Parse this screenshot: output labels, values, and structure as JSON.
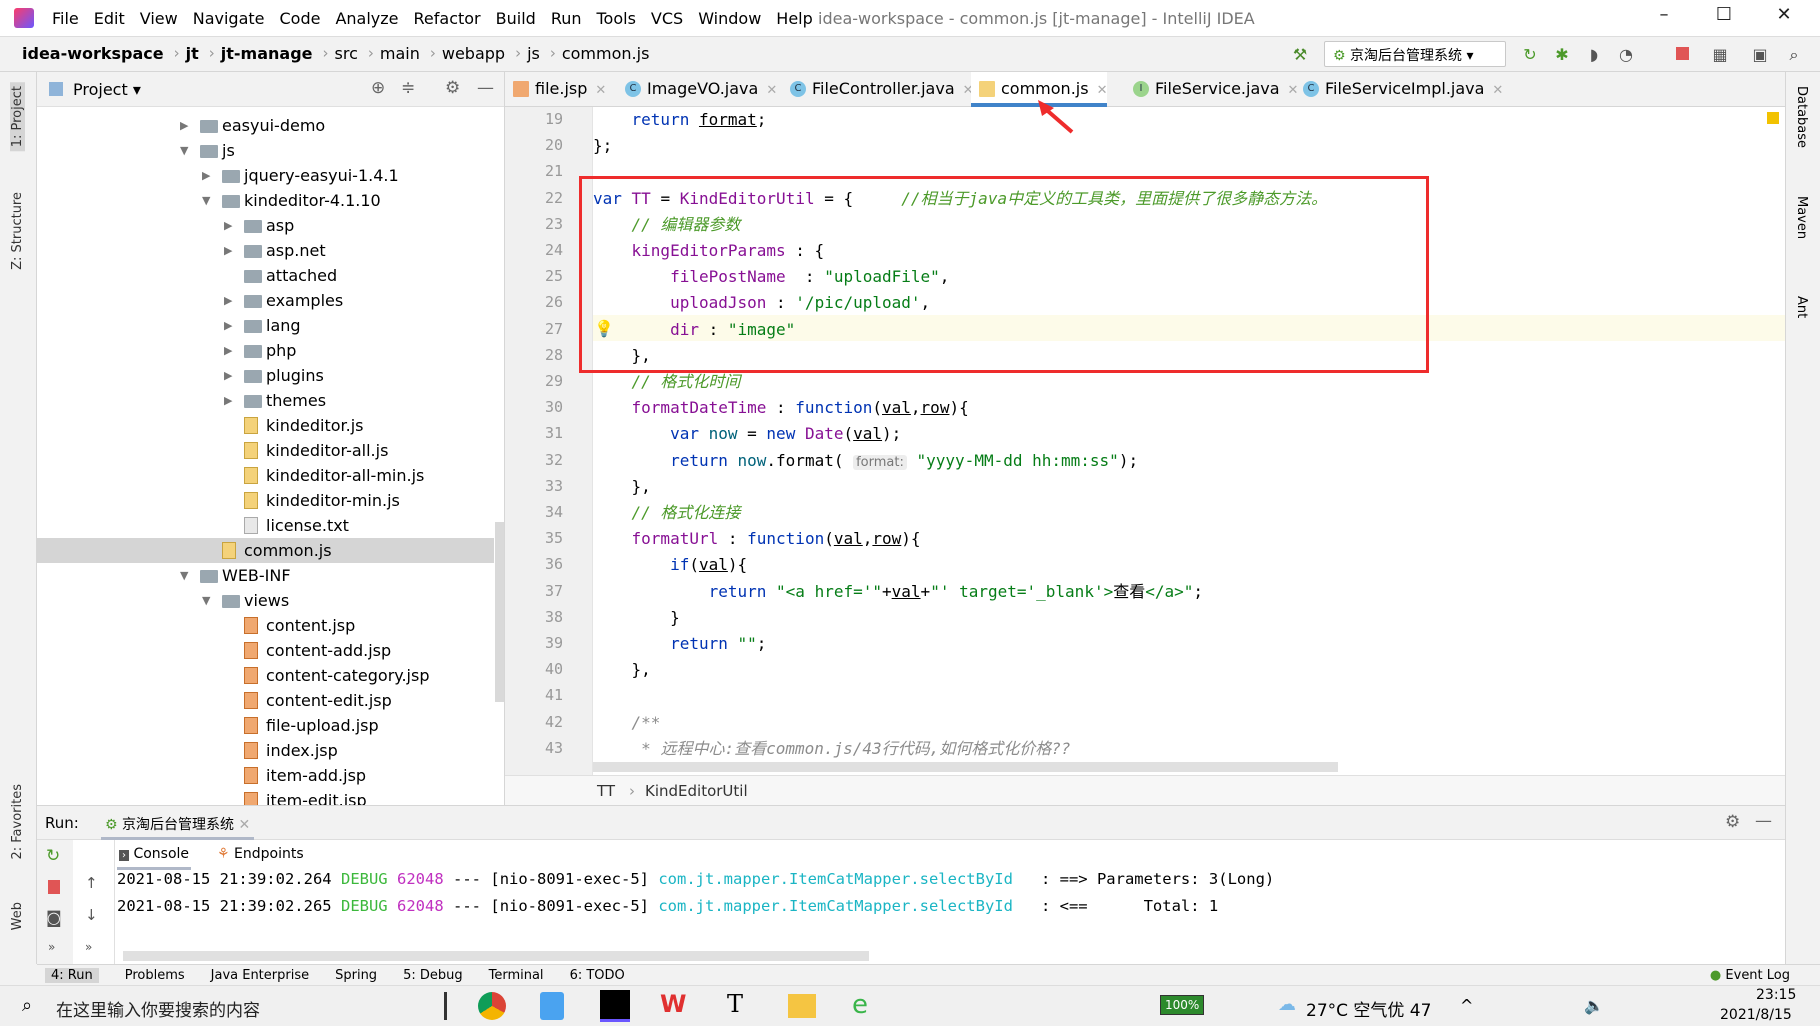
{
  "window": {
    "title": "idea-workspace - common.js [jt-manage] - IntelliJ IDEA",
    "menu": [
      "File",
      "Edit",
      "View",
      "Navigate",
      "Code",
      "Analyze",
      "Refactor",
      "Build",
      "Run",
      "Tools",
      "VCS",
      "Window",
      "Help"
    ]
  },
  "nav": {
    "crumbs": [
      "idea-workspace",
      "jt",
      "jt-manage",
      "src",
      "main",
      "webapp",
      "js",
      "common.js"
    ],
    "run_config": "京淘后台管理系统"
  },
  "leftstrip": {
    "project": "1: Project",
    "structure": "Z: Structure",
    "favorites": "2: Favorites",
    "web": "Web"
  },
  "rightstrip": {
    "database": "Database",
    "maven": "Maven",
    "ant": "Ant"
  },
  "project": {
    "title": "Project",
    "tree": [
      {
        "label": "easyui-demo",
        "level": 0,
        "type": "folder",
        "arrow": "collapsed"
      },
      {
        "label": "js",
        "level": 0,
        "type": "folder",
        "arrow": "expanded"
      },
      {
        "label": "jquery-easyui-1.4.1",
        "level": 1,
        "type": "folder",
        "arrow": "collapsed"
      },
      {
        "label": "kindeditor-4.1.10",
        "level": 1,
        "type": "folder",
        "arrow": "expanded"
      },
      {
        "label": "asp",
        "level": 2,
        "type": "folder",
        "arrow": "collapsed"
      },
      {
        "label": "asp.net",
        "level": 2,
        "type": "folder",
        "arrow": "collapsed"
      },
      {
        "label": "attached",
        "level": 2,
        "type": "folder",
        "arrow": ""
      },
      {
        "label": "examples",
        "level": 2,
        "type": "folder",
        "arrow": "collapsed"
      },
      {
        "label": "lang",
        "level": 2,
        "type": "folder",
        "arrow": "collapsed"
      },
      {
        "label": "php",
        "level": 2,
        "type": "folder",
        "arrow": "collapsed"
      },
      {
        "label": "plugins",
        "level": 2,
        "type": "folder",
        "arrow": "collapsed"
      },
      {
        "label": "themes",
        "level": 2,
        "type": "folder",
        "arrow": "collapsed"
      },
      {
        "label": "kindeditor.js",
        "level": 2,
        "type": "js",
        "arrow": ""
      },
      {
        "label": "kindeditor-all.js",
        "level": 2,
        "type": "js",
        "arrow": ""
      },
      {
        "label": "kindeditor-all-min.js",
        "level": 2,
        "type": "js",
        "arrow": ""
      },
      {
        "label": "kindeditor-min.js",
        "level": 2,
        "type": "js",
        "arrow": ""
      },
      {
        "label": "license.txt",
        "level": 2,
        "type": "txt",
        "arrow": ""
      },
      {
        "label": "common.js",
        "level": 1,
        "type": "js",
        "arrow": "",
        "selected": true
      },
      {
        "label": "WEB-INF",
        "level": 0,
        "type": "folder",
        "arrow": "expanded"
      },
      {
        "label": "views",
        "level": 1,
        "type": "folder",
        "arrow": "expanded"
      },
      {
        "label": "content.jsp",
        "level": 2,
        "type": "jsp",
        "arrow": ""
      },
      {
        "label": "content-add.jsp",
        "level": 2,
        "type": "jsp",
        "arrow": ""
      },
      {
        "label": "content-category.jsp",
        "level": 2,
        "type": "jsp",
        "arrow": ""
      },
      {
        "label": "content-edit.jsp",
        "level": 2,
        "type": "jsp",
        "arrow": ""
      },
      {
        "label": "file-upload.jsp",
        "level": 2,
        "type": "jsp",
        "arrow": ""
      },
      {
        "label": "index.jsp",
        "level": 2,
        "type": "jsp",
        "arrow": ""
      },
      {
        "label": "item-add.jsp",
        "level": 2,
        "type": "jsp",
        "arrow": ""
      },
      {
        "label": "item-edit.jsp",
        "level": 2,
        "type": "jsp",
        "arrow": ""
      }
    ]
  },
  "tabs": [
    {
      "label": "file.jsp",
      "icon": "jsp"
    },
    {
      "label": "ImageVO.java",
      "icon": "C"
    },
    {
      "label": "FileController.java",
      "icon": "C"
    },
    {
      "label": "common.js",
      "icon": "js",
      "active": true
    },
    {
      "label": "FileService.java",
      "icon": "I"
    },
    {
      "label": "FileServiceImpl.java",
      "icon": "C"
    }
  ],
  "editor": {
    "first_line": 19,
    "lines": [
      [
        [
          "    ",
          "pl"
        ],
        [
          "return",
          "kw"
        ],
        [
          " ",
          "pl"
        ],
        [
          "format",
          "pl ul"
        ],
        [
          ";",
          "pl"
        ]
      ],
      [
        [
          "};",
          "pl"
        ]
      ],
      [],
      [
        [
          "var",
          "kw"
        ],
        [
          " TT",
          "id"
        ],
        [
          " = ",
          "pl"
        ],
        [
          "KindEditorUtil",
          "id"
        ],
        [
          " = {     ",
          "pl"
        ],
        [
          "//相当于java中定义的工具类，里面提供了很多静态方法。",
          "cm"
        ]
      ],
      [
        [
          "    ",
          "pl"
        ],
        [
          "// 编辑器参数",
          "cm"
        ]
      ],
      [
        [
          "    ",
          "pl"
        ],
        [
          "kingEditorParams",
          "id"
        ],
        [
          " : {",
          "pl"
        ]
      ],
      [
        [
          "        ",
          "pl"
        ],
        [
          "filePostName",
          "id"
        ],
        [
          "  : ",
          "pl"
        ],
        [
          "\"uploadFile\"",
          "str"
        ],
        [
          ",",
          "pl"
        ]
      ],
      [
        [
          "        ",
          "pl"
        ],
        [
          "uploadJson",
          "id"
        ],
        [
          " : ",
          "pl"
        ],
        [
          "'/pic/upload'",
          "str"
        ],
        [
          ",",
          "pl"
        ]
      ],
      [
        [
          "        ",
          "pl"
        ],
        [
          "dir",
          "id"
        ],
        [
          " : ",
          "pl"
        ],
        [
          "\"image\"",
          "str"
        ]
      ],
      [
        [
          "    },",
          "pl"
        ]
      ],
      [
        [
          "    ",
          "pl"
        ],
        [
          "// 格式化时间",
          "cm"
        ]
      ],
      [
        [
          "    ",
          "pl"
        ],
        [
          "formatDateTime",
          "id"
        ],
        [
          " : ",
          "pl"
        ],
        [
          "function",
          "kw"
        ],
        [
          "(",
          "pl"
        ],
        [
          "val",
          "pl ul"
        ],
        [
          ",",
          "pl"
        ],
        [
          "row",
          "pl ul"
        ],
        [
          "){",
          "pl"
        ]
      ],
      [
        [
          "        ",
          "pl"
        ],
        [
          "var",
          "kw"
        ],
        [
          " ",
          "pl"
        ],
        [
          "now",
          "fn"
        ],
        [
          " = ",
          "pl"
        ],
        [
          "new",
          "kw"
        ],
        [
          " ",
          "pl"
        ],
        [
          "Date",
          "id"
        ],
        [
          "(",
          "pl"
        ],
        [
          "val",
          "pl ul"
        ],
        [
          ");",
          "pl"
        ]
      ],
      [
        [
          "        ",
          "pl"
        ],
        [
          "return",
          "kw"
        ],
        [
          " ",
          "pl"
        ],
        [
          "now",
          "fn"
        ],
        [
          ".format( ",
          "pl"
        ],
        [
          "format:",
          "hint"
        ],
        [
          " ",
          "pl"
        ],
        [
          "\"yyyy-MM-dd hh:mm:ss\"",
          "str"
        ],
        [
          ");",
          "pl"
        ]
      ],
      [
        [
          "    },",
          "pl"
        ]
      ],
      [
        [
          "    ",
          "pl"
        ],
        [
          "// 格式化连接",
          "cm"
        ]
      ],
      [
        [
          "    ",
          "pl"
        ],
        [
          "formatUrl",
          "id"
        ],
        [
          " : ",
          "pl"
        ],
        [
          "function",
          "kw"
        ],
        [
          "(",
          "pl"
        ],
        [
          "val",
          "pl ul"
        ],
        [
          ",",
          "pl"
        ],
        [
          "row",
          "pl ul"
        ],
        [
          "){",
          "pl"
        ]
      ],
      [
        [
          "        ",
          "pl"
        ],
        [
          "if",
          "kw"
        ],
        [
          "(",
          "pl"
        ],
        [
          "val",
          "pl ul"
        ],
        [
          "){",
          "pl"
        ]
      ],
      [
        [
          "            ",
          "pl"
        ],
        [
          "return",
          "kw"
        ],
        [
          " ",
          "pl"
        ],
        [
          "\"<a href='\"",
          "str"
        ],
        [
          "+",
          "pl"
        ],
        [
          "val",
          "pl ul"
        ],
        [
          "+",
          "pl"
        ],
        [
          "\"' target='_blank'>",
          "str"
        ],
        [
          "查看",
          "pl"
        ],
        [
          "</a>\"",
          "str"
        ],
        [
          ";",
          "pl"
        ]
      ],
      [
        [
          "        }",
          "pl"
        ]
      ],
      [
        [
          "        ",
          "pl"
        ],
        [
          "return",
          "kw"
        ],
        [
          " ",
          "pl"
        ],
        [
          "\"\"",
          "str"
        ],
        [
          ";",
          "pl"
        ]
      ],
      [
        [
          "    },",
          "pl"
        ]
      ],
      [],
      [
        [
          "    ",
          "pl"
        ],
        [
          "/**",
          "dc"
        ]
      ],
      [
        [
          "     ",
          "pl"
        ],
        [
          "* 远程中心:查看common.js/43行代码,如何格式化价格??",
          "dc"
        ]
      ]
    ],
    "breadcrumb": [
      "TT",
      "KindEditorUtil"
    ]
  },
  "run": {
    "label": "Run:",
    "config": "京淘后台管理系统",
    "subtabs": [
      "Console",
      "Endpoints"
    ],
    "log": [
      {
        "ts": "2021-08-15 21:39:02.264",
        "level": "DEBUG",
        "pid": "62048",
        "sep": "---",
        "thread": "[nio-8091-exec-5]",
        "logger": "com.jt.mapper.ItemCatMapper.selectById",
        "msg": ": ==> Parameters: 3(Long)"
      },
      {
        "ts": "2021-08-15 21:39:02.265",
        "level": "DEBUG",
        "pid": "62048",
        "sep": "---",
        "thread": "[nio-8091-exec-5]",
        "logger": "com.jt.mapper.ItemCatMapper.selectById",
        "msg": ": <==      Total: 1"
      }
    ]
  },
  "toolwindows": [
    "4: Run",
    "Problems",
    "Java Enterprise",
    "Spring",
    "5: Debug",
    "Terminal",
    "6: TODO"
  ],
  "event_log": "Event Log",
  "taskbar": {
    "search_placeholder": "在这里输入你要搜索的内容",
    "battery": "100%",
    "weather": "27°C 空气优 47",
    "time": "23:15",
    "date": "2021/8/15"
  }
}
